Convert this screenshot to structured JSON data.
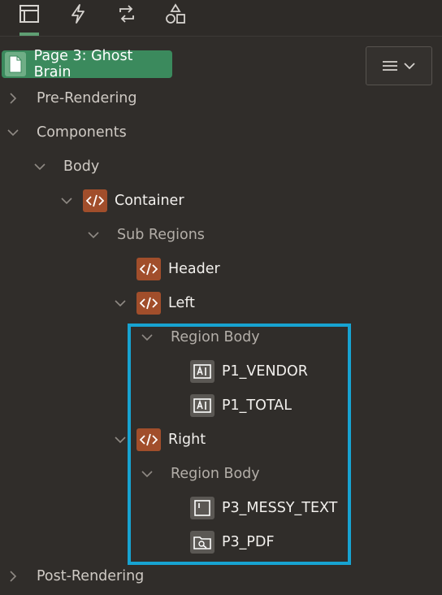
{
  "toolbar": {
    "tabs": [
      {
        "icon": "rendering-tree-icon",
        "active": true
      },
      {
        "icon": "lightning-icon",
        "active": false
      },
      {
        "icon": "processing-loop-icon",
        "active": false
      },
      {
        "icon": "shared-components-icon",
        "active": false
      }
    ]
  },
  "page_badge": {
    "label": "Page 3: Ghost Brain"
  },
  "tree": {
    "pre_rendering": "Pre-Rendering",
    "components": "Components",
    "body": "Body",
    "container": "Container",
    "sub_regions": "Sub Regions",
    "header": "Header",
    "left": "Left",
    "left_region_body": "Region Body",
    "p1_vendor": "P1_VENDOR",
    "p1_total": "P1_TOTAL",
    "right": "Right",
    "right_region_body": "Region Body",
    "p3_messy_text": "P3_MESSY_TEXT",
    "p3_pdf": "P3_PDF",
    "post_rendering": "Post-Rendering"
  },
  "colors": {
    "background": "#302d2a",
    "page_badge": "#3b8a5d",
    "region_icon": "#a14e2b",
    "highlight": "#17a3d1",
    "active_tab": "#5f9e73"
  }
}
